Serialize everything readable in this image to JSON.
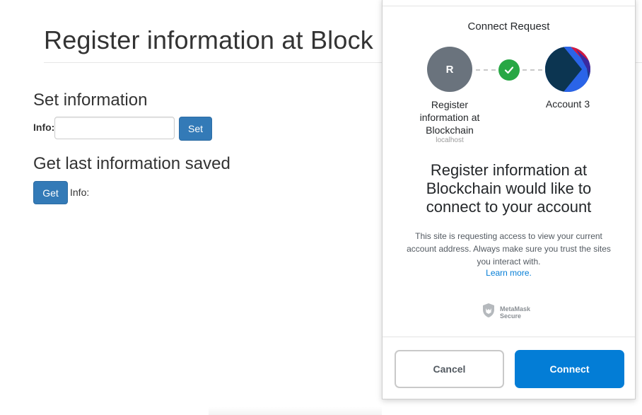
{
  "dapp": {
    "title": "Register information at Block",
    "set_section": {
      "heading": "Set information",
      "info_label": "Info:",
      "info_value": "",
      "set_button": "Set"
    },
    "get_section": {
      "heading": "Get last information saved",
      "get_button": "Get",
      "info_label": "Info:"
    }
  },
  "metamask": {
    "title": "Connect Request",
    "site": {
      "initial": "R",
      "name": "Register information at Blockchain",
      "host": "localhost"
    },
    "account": {
      "name": "Account 3"
    },
    "headline": "Register information at Blockchain would like to connect to your account",
    "description": "This site is requesting access to view your current account address. Always make sure you trust the sites you interact with.",
    "learn_more": "Learn more.",
    "secure_line1": "MetaMask",
    "secure_line2": "Secure",
    "cancel_button": "Cancel",
    "connect_button": "Connect"
  },
  "colors": {
    "bootstrap_primary": "#337ab7",
    "metamask_blue": "#037dd6",
    "success_green": "#28a745",
    "site_avatar_gray": "#6a737d"
  },
  "icons": [
    "check-icon",
    "metamask-shield-icon",
    "account-identicon"
  ]
}
